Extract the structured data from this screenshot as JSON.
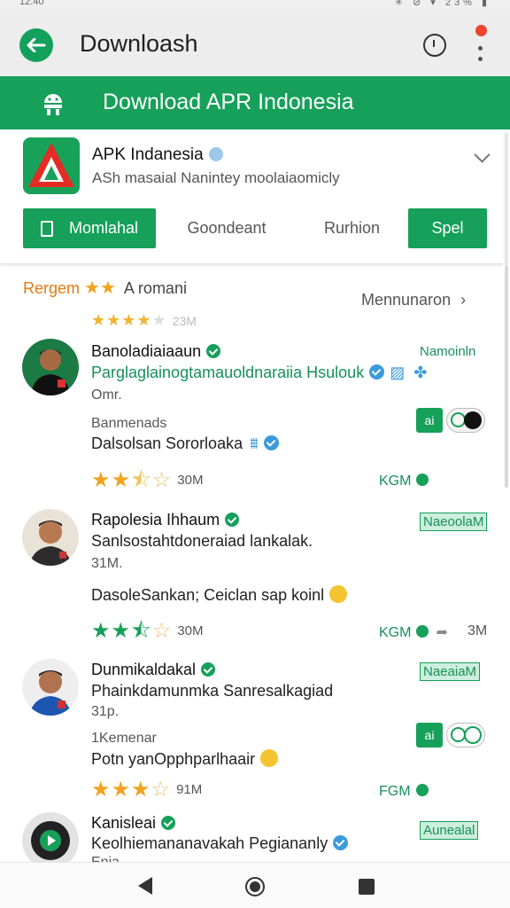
{
  "status_bar": {
    "time": "12:40",
    "right": "✳ ⊘ ▾ 23% ▮"
  },
  "app_bar": {
    "title": "Downloash"
  },
  "banner": {
    "title": "Download APR Indonesia"
  },
  "app_card": {
    "name": "APK Indanesia",
    "subtitle": "ASh masaial Nanintey moolaiaomicly",
    "tabs": [
      "Momlahal",
      "Goondeant",
      "Rurhion",
      "Spel"
    ]
  },
  "ratings_header": {
    "label": "Rergem",
    "stars": "★★",
    "text": "A romani",
    "recommend": "Mennunaron",
    "summary_count": "23M"
  },
  "reviews": [
    {
      "name": "Banoladiaiaaun",
      "tag": "Namoinln",
      "headline": "Parglaglainogtamauoldnaraiia Hsulouk",
      "line2": "Omr.",
      "meta": "Banmenads",
      "body": "Dalsolsan Sororloaka",
      "count": "30M",
      "kcount": "KGM",
      "toggle_label": "ai"
    },
    {
      "name": "Rapolesia Ihhaum",
      "tag": "NaeoolaM",
      "headline": "Sanlsostahtdoneraiad lankalak.",
      "line2": "31M.",
      "body": "DasoleSankan; Ceiclan sap koinl",
      "count": "30M",
      "kcount": "KGM",
      "extra": "3M"
    },
    {
      "name": "Dunmikaldakal",
      "tag": "NaeaiaM",
      "headline": "Phainkdamunmka Sanresalkagiad",
      "line2": "31p.",
      "meta": "1Kemenar",
      "body": "Potn yanOpphparlhaair",
      "count": "91M",
      "kcount": "FGM",
      "toggle_label": "ai"
    },
    {
      "name": "Kanisleai",
      "tag": "Aunealal",
      "headline": "Keolhiemananavakah Pegiananly",
      "line2": "Enia"
    }
  ],
  "colors": {
    "accent": "#16a05a",
    "star": "#f2a21c",
    "blue": "#3a9bdc"
  }
}
